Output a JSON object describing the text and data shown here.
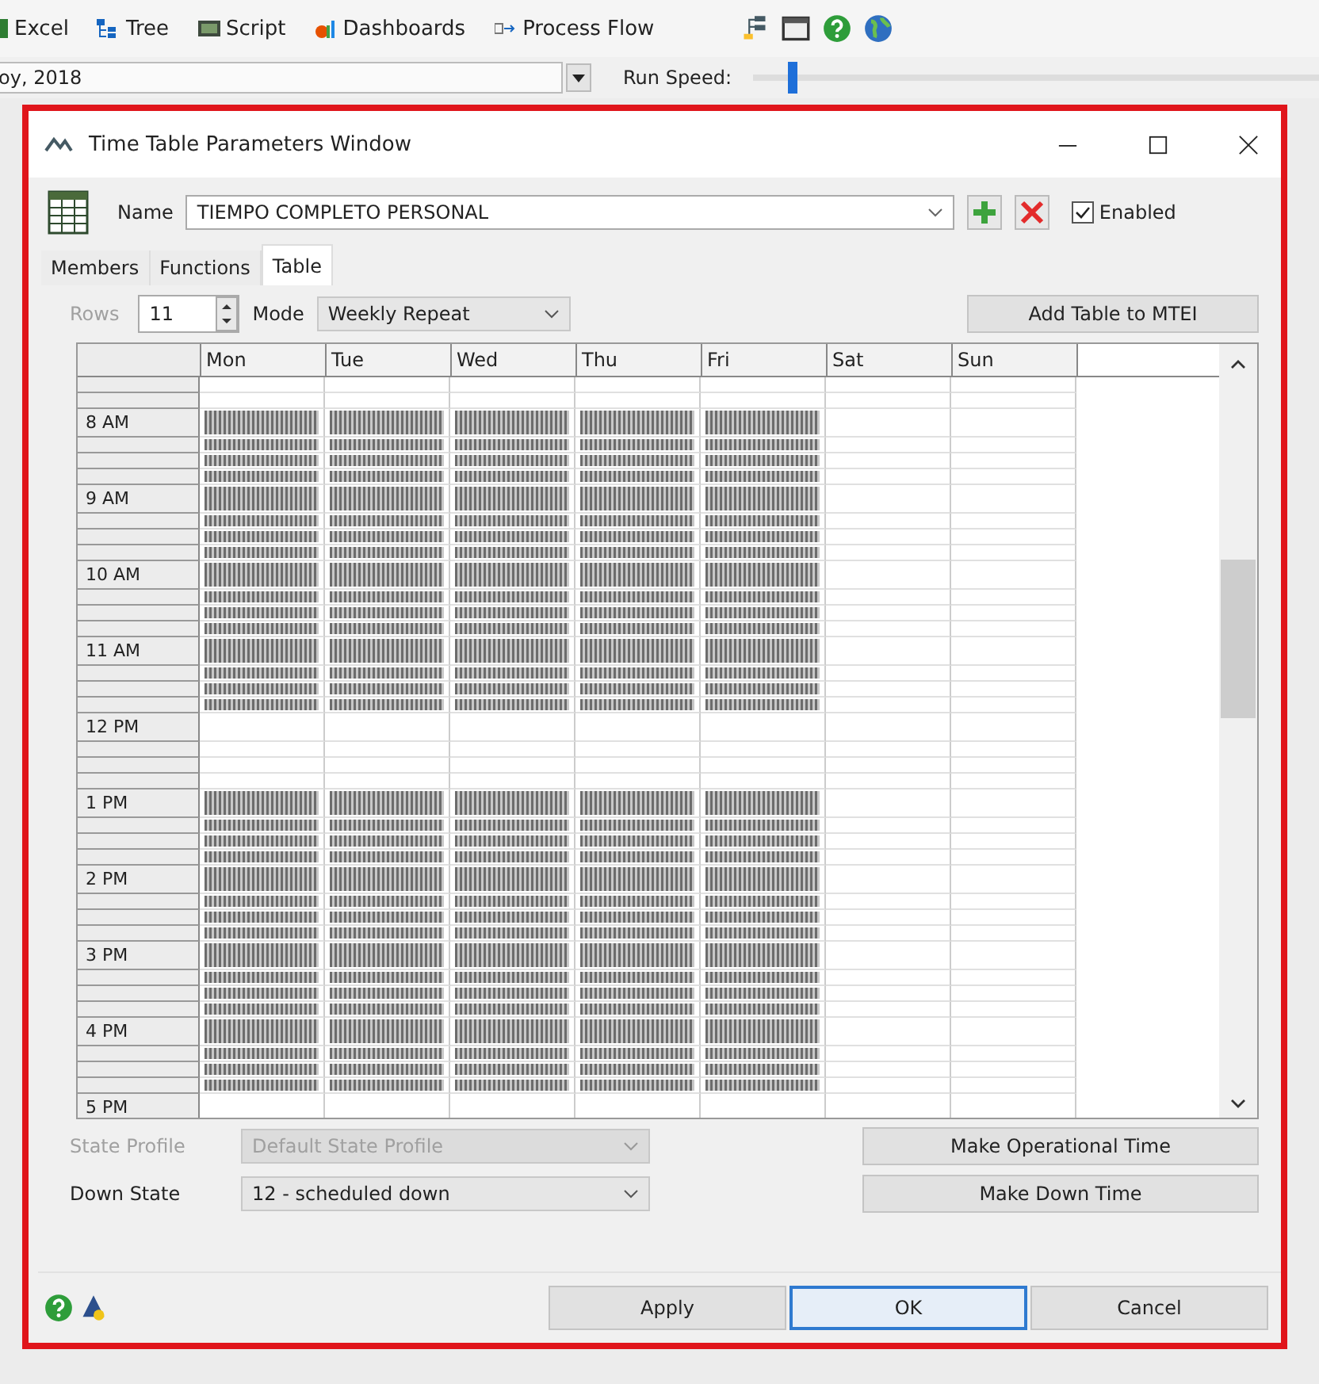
{
  "app_toolbar": {
    "items": [
      {
        "label": "Excel",
        "kind": "excel"
      },
      {
        "label": "Tree",
        "kind": "tree"
      },
      {
        "label": "Script",
        "kind": "script"
      },
      {
        "label": "Dashboards",
        "kind": "dashboards"
      },
      {
        "label": "Process Flow",
        "kind": "flow"
      }
    ]
  },
  "run_bar": {
    "date_value": "oy, 2018",
    "run_speed_label": "Run Speed:",
    "run_speed": {
      "level": 0.06
    }
  },
  "dialog": {
    "title": "Time Table Parameters Window",
    "name_label": "Name",
    "name_value": "TIEMPO COMPLETO PERSONAL",
    "enabled": {
      "label": "Enabled",
      "checked": true
    },
    "tabs": [
      {
        "label": "Members",
        "selected": false
      },
      {
        "label": "Functions",
        "selected": false
      },
      {
        "label": "Table",
        "selected": true
      }
    ],
    "rows_label": {
      "text": "Rows",
      "disabled": true
    },
    "rows_value": "11",
    "mode_label": "Mode",
    "mode_value": "Weekly Repeat",
    "add_table_button": "Add Table to MTEI",
    "table": {
      "columns": [
        "Mon",
        "Tue",
        "Wed",
        "Thu",
        "Fri",
        "Sat",
        "Sun"
      ],
      "rows": [
        {
          "active": [
            false,
            false,
            false,
            false,
            false,
            false,
            false
          ]
        },
        {
          "active": [
            false,
            false,
            false,
            false,
            false,
            false,
            false
          ]
        },
        {
          "label": "8 AM",
          "active": [
            true,
            true,
            true,
            true,
            true,
            false,
            false
          ]
        },
        {
          "active": [
            true,
            true,
            true,
            true,
            true,
            false,
            false
          ]
        },
        {
          "active": [
            true,
            true,
            true,
            true,
            true,
            false,
            false
          ]
        },
        {
          "active": [
            true,
            true,
            true,
            true,
            true,
            false,
            false
          ]
        },
        {
          "label": "9 AM",
          "active": [
            true,
            true,
            true,
            true,
            true,
            false,
            false
          ]
        },
        {
          "active": [
            true,
            true,
            true,
            true,
            true,
            false,
            false
          ]
        },
        {
          "active": [
            true,
            true,
            true,
            true,
            true,
            false,
            false
          ]
        },
        {
          "active": [
            true,
            true,
            true,
            true,
            true,
            false,
            false
          ]
        },
        {
          "label": "10 AM",
          "active": [
            true,
            true,
            true,
            true,
            true,
            false,
            false
          ]
        },
        {
          "active": [
            true,
            true,
            true,
            true,
            true,
            false,
            false
          ]
        },
        {
          "active": [
            true,
            true,
            true,
            true,
            true,
            false,
            false
          ]
        },
        {
          "active": [
            true,
            true,
            true,
            true,
            true,
            false,
            false
          ]
        },
        {
          "label": "11 AM",
          "active": [
            true,
            true,
            true,
            true,
            true,
            false,
            false
          ]
        },
        {
          "active": [
            true,
            true,
            true,
            true,
            true,
            false,
            false
          ]
        },
        {
          "active": [
            true,
            true,
            true,
            true,
            true,
            false,
            false
          ]
        },
        {
          "active": [
            true,
            true,
            true,
            true,
            true,
            false,
            false
          ]
        },
        {
          "label": "12 PM",
          "active": [
            false,
            false,
            false,
            false,
            false,
            false,
            false
          ]
        },
        {
          "active": [
            false,
            false,
            false,
            false,
            false,
            false,
            false
          ]
        },
        {
          "active": [
            false,
            false,
            false,
            false,
            false,
            false,
            false
          ]
        },
        {
          "active": [
            false,
            false,
            false,
            false,
            false,
            false,
            false
          ]
        },
        {
          "label": "1 PM",
          "active": [
            true,
            true,
            true,
            true,
            true,
            false,
            false
          ]
        },
        {
          "active": [
            true,
            true,
            true,
            true,
            true,
            false,
            false
          ]
        },
        {
          "active": [
            true,
            true,
            true,
            true,
            true,
            false,
            false
          ]
        },
        {
          "active": [
            true,
            true,
            true,
            true,
            true,
            false,
            false
          ]
        },
        {
          "label": "2 PM",
          "active": [
            true,
            true,
            true,
            true,
            true,
            false,
            false
          ]
        },
        {
          "active": [
            true,
            true,
            true,
            true,
            true,
            false,
            false
          ]
        },
        {
          "active": [
            true,
            true,
            true,
            true,
            true,
            false,
            false
          ]
        },
        {
          "active": [
            true,
            true,
            true,
            true,
            true,
            false,
            false
          ]
        },
        {
          "label": "3 PM",
          "active": [
            true,
            true,
            true,
            true,
            true,
            false,
            false
          ]
        },
        {
          "active": [
            true,
            true,
            true,
            true,
            true,
            false,
            false
          ]
        },
        {
          "active": [
            true,
            true,
            true,
            true,
            true,
            false,
            false
          ]
        },
        {
          "active": [
            true,
            true,
            true,
            true,
            true,
            false,
            false
          ]
        },
        {
          "label": "4 PM",
          "active": [
            true,
            true,
            true,
            true,
            true,
            false,
            false
          ]
        },
        {
          "active": [
            true,
            true,
            true,
            true,
            true,
            false,
            false
          ]
        },
        {
          "active": [
            true,
            true,
            true,
            true,
            true,
            false,
            false
          ]
        },
        {
          "active": [
            true,
            true,
            true,
            true,
            true,
            false,
            false
          ]
        },
        {
          "label": "5 PM",
          "active": [
            false,
            false,
            false,
            false,
            false,
            false,
            false
          ]
        }
      ]
    },
    "state_profile": {
      "label": "State Profile",
      "value": "Default State Profile",
      "disabled": true
    },
    "down_state": {
      "label": "Down State",
      "value": "12 - scheduled down",
      "disabled": false
    },
    "make_operational_button": "Make Operational Time",
    "make_down_button": "Make Down Time",
    "footer_buttons": [
      {
        "label": "Apply",
        "focused": false
      },
      {
        "label": "OK",
        "focused": true
      },
      {
        "label": "Cancel",
        "focused": false
      }
    ]
  }
}
